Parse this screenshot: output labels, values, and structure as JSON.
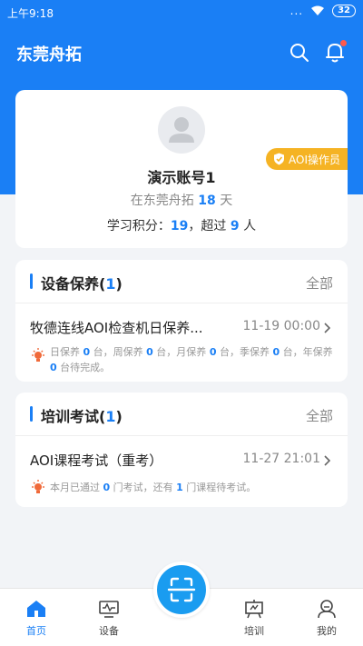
{
  "status_bar": {
    "time": "上午9:18",
    "dots": "...",
    "battery": "32"
  },
  "header": {
    "title": "东莞舟拓"
  },
  "profile": {
    "name": "演示账号1",
    "role": "AOI操作员",
    "tenure_prefix": "在东莞舟拓",
    "tenure_days": "18",
    "tenure_suffix": "天",
    "points_prefix": "学习积分：",
    "points": "19",
    "points_mid": "，超过",
    "rank": "9",
    "points_suffix": "人"
  },
  "maintenance": {
    "title": "设备保养",
    "count": "1",
    "all_label": "全部",
    "task": "牧德连线AOI检查机日保养...",
    "time": "11-19 00:00",
    "note": [
      {
        "t": "日保养 "
      },
      {
        "n": "0"
      },
      {
        "t": " 台，周保养 "
      },
      {
        "n": "0"
      },
      {
        "t": " 台，月保养 "
      },
      {
        "n": "0"
      },
      {
        "t": " 台，季保养 "
      },
      {
        "n": "0"
      },
      {
        "t": " 台，年保养 "
      },
      {
        "n": "0"
      },
      {
        "t": " 台待完成。"
      }
    ]
  },
  "training": {
    "title": "培训考试",
    "count": "1",
    "all_label": "全部",
    "task": "AOI课程考试（重考）",
    "time": "11-27 21:01",
    "note": [
      {
        "t": "本月已通过 "
      },
      {
        "n": "0"
      },
      {
        "t": " 门考试，还有 "
      },
      {
        "n": "1"
      },
      {
        "t": " 门课程待考试。"
      }
    ]
  },
  "tabbar": {
    "home": "首页",
    "device": "设备",
    "training": "培训",
    "mine": "我的"
  },
  "colors": {
    "primary": "#1a7ff5",
    "badge": "#f5b324",
    "alert_dot": "#ff5a4d"
  }
}
